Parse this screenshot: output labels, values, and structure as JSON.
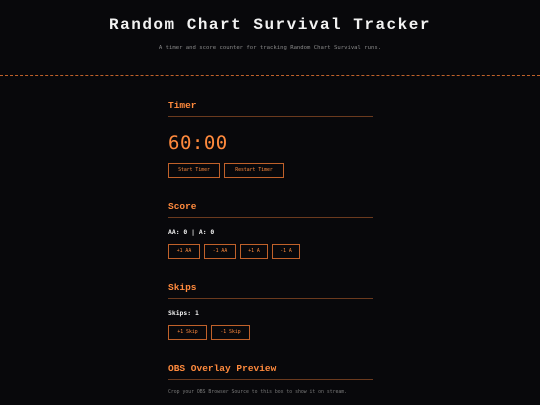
{
  "header": {
    "title": "Random Chart Survival Tracker",
    "subtitle": "A timer and score counter for tracking Random Chart Survival runs."
  },
  "timer": {
    "heading": "Timer",
    "display": "60:00",
    "start_label": "Start Timer",
    "restart_label": "Restart Timer"
  },
  "score": {
    "heading": "Score",
    "aa_label": "AA:",
    "aa_value": "0",
    "separator": "|",
    "a_label": "A:",
    "a_value": "0",
    "buttons": [
      "+1 AA",
      "-1 AA",
      "+1 A",
      "-1 A"
    ]
  },
  "skips": {
    "heading": "Skips",
    "label": "Skips:",
    "value": "1",
    "buttons": [
      "+1 Skip",
      "-1 Skip"
    ]
  },
  "obs": {
    "heading": "OBS Overlay Preview",
    "note": "Crop your OBS Browser Source to this box to show it on stream."
  },
  "colors": {
    "background": "#08080b",
    "accent": "#ff8a3d",
    "border": "#c0612a",
    "text": "#f0f0f0",
    "muted": "#8a8a8a"
  }
}
